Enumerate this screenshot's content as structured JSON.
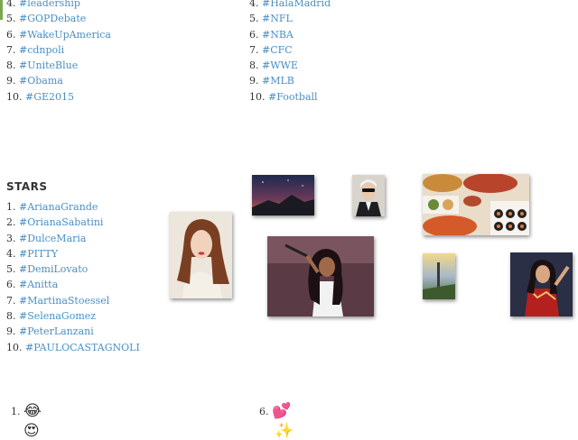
{
  "left_list": [
    {
      "num": "4.",
      "tag": "#leadership"
    },
    {
      "num": "5.",
      "tag": "#GOPDebate"
    },
    {
      "num": "6.",
      "tag": "#WakeUpAmerica"
    },
    {
      "num": "7.",
      "tag": "#cdnpoli"
    },
    {
      "num": "8.",
      "tag": "#UniteBlue"
    },
    {
      "num": "9.",
      "tag": "#Obama"
    },
    {
      "num": "10.",
      "tag": "#GE2015"
    }
  ],
  "right_list": [
    {
      "num": "4.",
      "tag": "#HalaMadrid"
    },
    {
      "num": "5.",
      "tag": "#NFL"
    },
    {
      "num": "6.",
      "tag": "#NBA"
    },
    {
      "num": "7.",
      "tag": "#CFC"
    },
    {
      "num": "8.",
      "tag": "#WWE"
    },
    {
      "num": "9.",
      "tag": "#MLB"
    },
    {
      "num": "10.",
      "tag": "#Football"
    }
  ],
  "stars": {
    "title": "STARS",
    "items": [
      {
        "num": "1.",
        "tag": "#ArianaGrande"
      },
      {
        "num": "2.",
        "tag": "#OrianaSabatini"
      },
      {
        "num": "3.",
        "tag": "#DulceMaria"
      },
      {
        "num": "4.",
        "tag": "#PITTY"
      },
      {
        "num": "5.",
        "tag": "#DemiLovato"
      },
      {
        "num": "6.",
        "tag": "#Anitta"
      },
      {
        "num": "7.",
        "tag": "#MartinaStoessel"
      },
      {
        "num": "8.",
        "tag": "#SelenaGomez"
      },
      {
        "num": "9.",
        "tag": "#PeterLanzani"
      },
      {
        "num": "10.",
        "tag": "#PAULOCASTAGNOLI"
      }
    ]
  },
  "emoji_rows": [
    {
      "num": "1.",
      "emoji": "😂"
    },
    {
      "num": "6.",
      "emoji": "💕"
    }
  ],
  "colors": {
    "link": "#4a8fc4",
    "accent_bar": "#7aa84c"
  }
}
